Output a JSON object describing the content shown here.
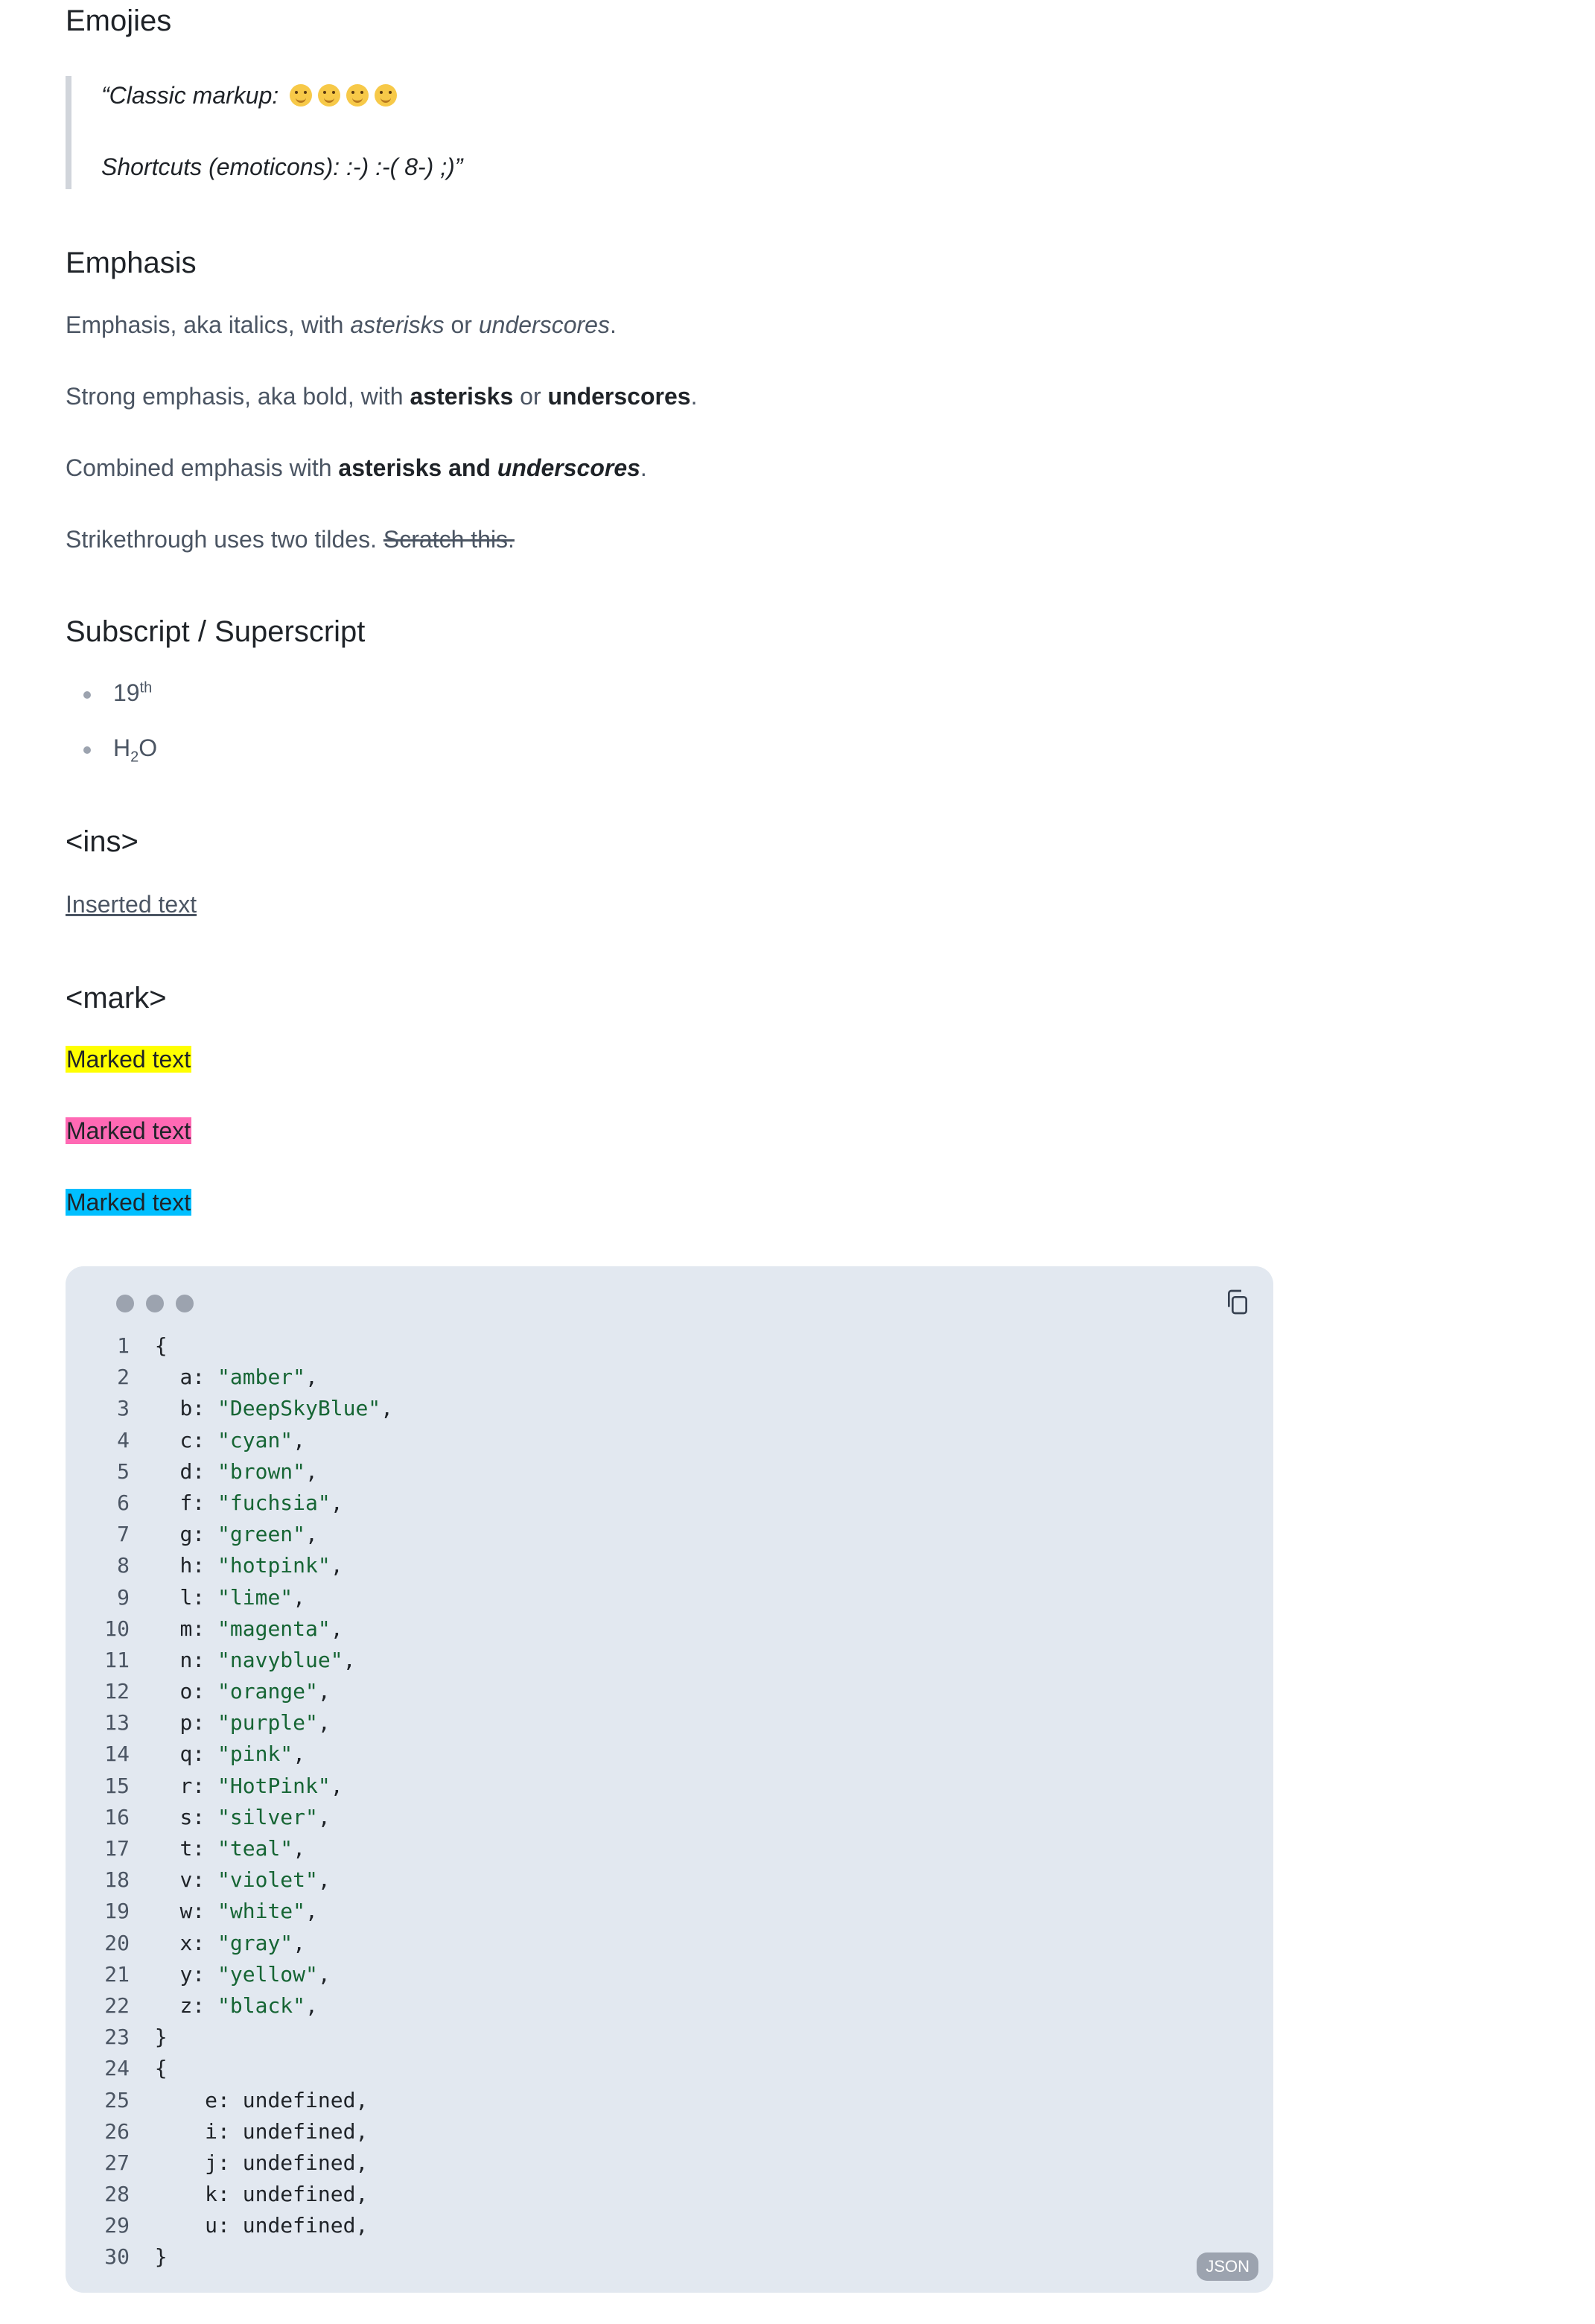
{
  "sections": {
    "emojies": {
      "heading": "Emojies",
      "classic_text": "“Classic markup:",
      "emoji_icons": [
        "winking-face-icon",
        "crying-laughing-face-icon",
        "grinning-squint-face-icon",
        "face-savoring-food-icon"
      ],
      "shortcuts_text": "Shortcuts (emoticons): :-) :-( 8-) ;)”"
    },
    "emphasis": {
      "heading": "Emphasis",
      "line1": {
        "prefix": "Emphasis, aka italics, with ",
        "a": "asterisks",
        "mid": " or ",
        "b": "underscores",
        "suffix": "."
      },
      "line2": {
        "prefix": "Strong emphasis, aka bold, with ",
        "a": "asterisks",
        "mid": " or ",
        "b": "underscores",
        "suffix": "."
      },
      "line3": {
        "prefix": "Combined emphasis with ",
        "a": "asterisks and ",
        "b": "underscores",
        "suffix": "."
      },
      "line4": {
        "prefix": "Strikethrough uses two tildes. ",
        "struck": "Scratch this."
      }
    },
    "subsup": {
      "heading": "Subscript / Superscript",
      "item1": {
        "base": "19",
        "sup": "th"
      },
      "item2": {
        "a": "H",
        "sub": "2",
        "b": "O"
      }
    },
    "ins": {
      "heading": "<ins>",
      "text": "Inserted text"
    },
    "mark": {
      "heading": "<mark>",
      "items": [
        {
          "text": "Marked text",
          "color": "#ffff00"
        },
        {
          "text": "Marked text",
          "color": "#ff69b4"
        },
        {
          "text": "Marked text",
          "color": "#00bfff"
        }
      ]
    }
  },
  "code_block": {
    "language_badge": "JSON",
    "copy_icon": "copy-icon",
    "lines": [
      {
        "n": "1",
        "indent": "",
        "key": "",
        "val": "",
        "raw": "{"
      },
      {
        "n": "2",
        "indent": "  ",
        "key": "a",
        "val": "\"amber\"",
        "raw": ""
      },
      {
        "n": "3",
        "indent": "  ",
        "key": "b",
        "val": "\"DeepSkyBlue\"",
        "raw": ""
      },
      {
        "n": "4",
        "indent": "  ",
        "key": "c",
        "val": "\"cyan\"",
        "raw": ""
      },
      {
        "n": "5",
        "indent": "  ",
        "key": "d",
        "val": "\"brown\"",
        "raw": ""
      },
      {
        "n": "6",
        "indent": "  ",
        "key": "f",
        "val": "\"fuchsia\"",
        "raw": ""
      },
      {
        "n": "7",
        "indent": "  ",
        "key": "g",
        "val": "\"green\"",
        "raw": ""
      },
      {
        "n": "8",
        "indent": "  ",
        "key": "h",
        "val": "\"hotpink\"",
        "raw": ""
      },
      {
        "n": "9",
        "indent": "  ",
        "key": "l",
        "val": "\"lime\"",
        "raw": ""
      },
      {
        "n": "10",
        "indent": "  ",
        "key": "m",
        "val": "\"magenta\"",
        "raw": ""
      },
      {
        "n": "11",
        "indent": "  ",
        "key": "n",
        "val": "\"navyblue\"",
        "raw": ""
      },
      {
        "n": "12",
        "indent": "  ",
        "key": "o",
        "val": "\"orange\"",
        "raw": ""
      },
      {
        "n": "13",
        "indent": "  ",
        "key": "p",
        "val": "\"purple\"",
        "raw": ""
      },
      {
        "n": "14",
        "indent": "  ",
        "key": "q",
        "val": "\"pink\"",
        "raw": ""
      },
      {
        "n": "15",
        "indent": "  ",
        "key": "r",
        "val": "\"HotPink\"",
        "raw": ""
      },
      {
        "n": "16",
        "indent": "  ",
        "key": "s",
        "val": "\"silver\"",
        "raw": ""
      },
      {
        "n": "17",
        "indent": "  ",
        "key": "t",
        "val": "\"teal\"",
        "raw": ""
      },
      {
        "n": "18",
        "indent": "  ",
        "key": "v",
        "val": "\"violet\"",
        "raw": ""
      },
      {
        "n": "19",
        "indent": "  ",
        "key": "w",
        "val": "\"white\"",
        "raw": ""
      },
      {
        "n": "20",
        "indent": "  ",
        "key": "x",
        "val": "\"gray\"",
        "raw": ""
      },
      {
        "n": "21",
        "indent": "  ",
        "key": "y",
        "val": "\"yellow\"",
        "raw": ""
      },
      {
        "n": "22",
        "indent": "  ",
        "key": "z",
        "val": "\"black\"",
        "raw": ""
      },
      {
        "n": "23",
        "indent": "",
        "key": "",
        "val": "",
        "raw": "}"
      },
      {
        "n": "24",
        "indent": "",
        "key": "",
        "val": "",
        "raw": "{"
      },
      {
        "n": "25",
        "indent": "    ",
        "key": "e",
        "val": "undefined",
        "raw": ""
      },
      {
        "n": "26",
        "indent": "    ",
        "key": "i",
        "val": "undefined",
        "raw": ""
      },
      {
        "n": "27",
        "indent": "    ",
        "key": "j",
        "val": "undefined",
        "raw": ""
      },
      {
        "n": "28",
        "indent": "    ",
        "key": "k",
        "val": "undefined",
        "raw": ""
      },
      {
        "n": "29",
        "indent": "    ",
        "key": "u",
        "val": "undefined",
        "raw": ""
      },
      {
        "n": "30",
        "indent": "",
        "key": "",
        "val": "",
        "raw": "}"
      }
    ]
  }
}
